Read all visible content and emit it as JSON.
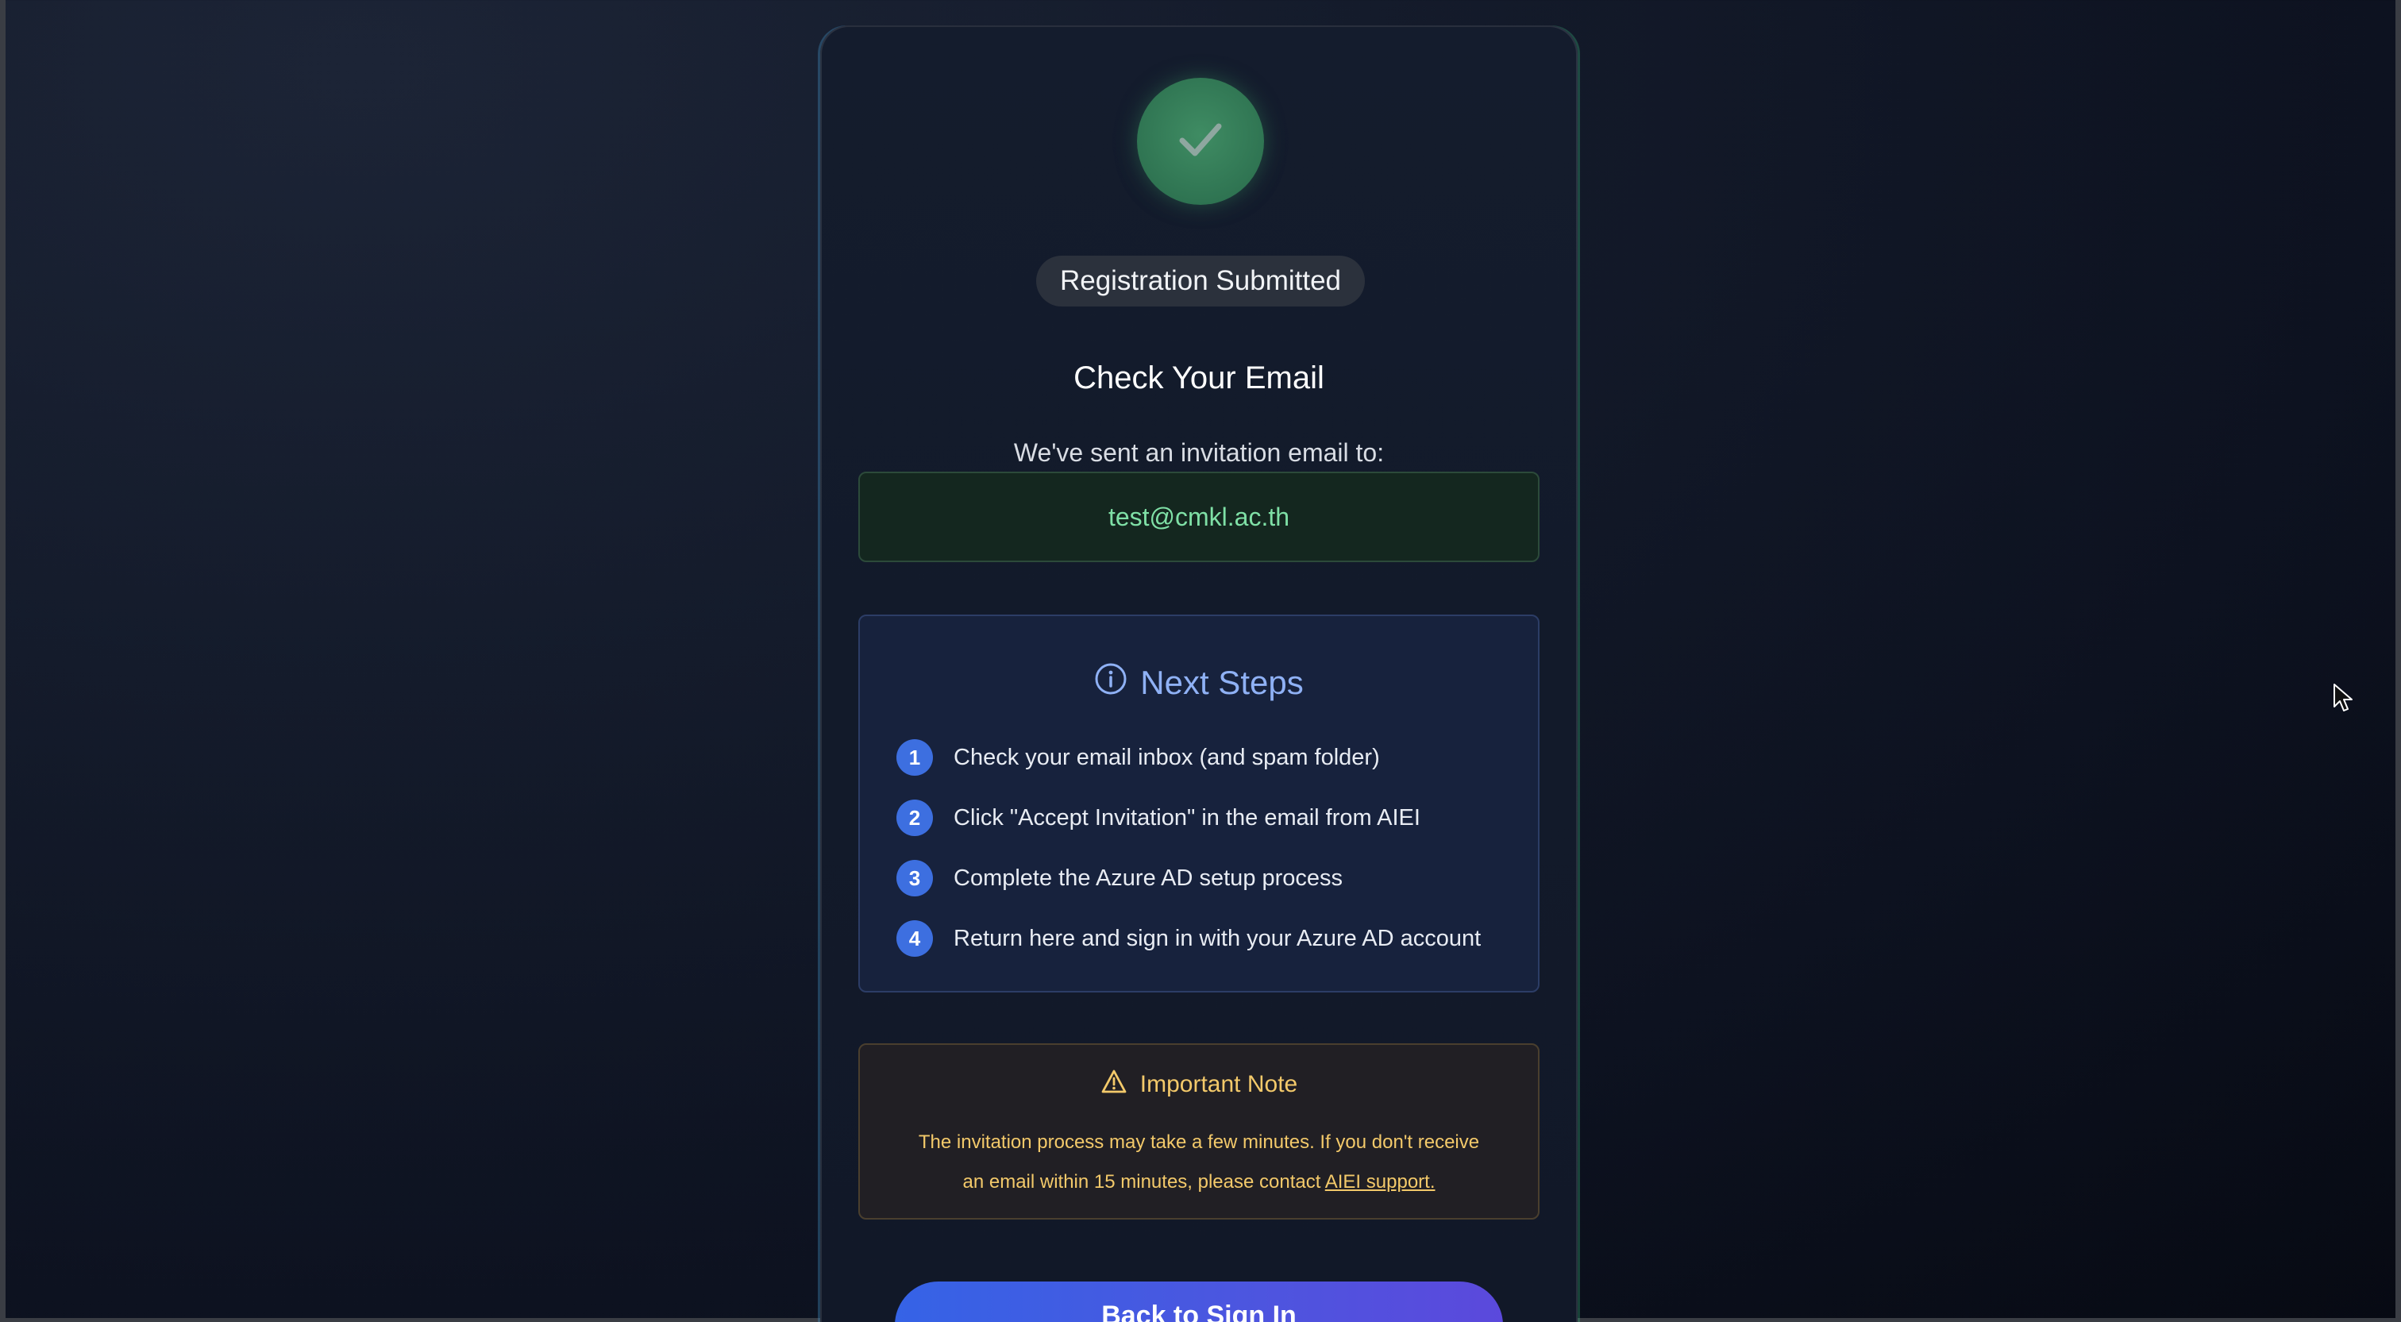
{
  "status_badge": "Registration Submitted",
  "title": "Check Your Email",
  "subtitle": "We've sent an invitation email to:",
  "email": "test@cmkl.ac.th",
  "next_steps": {
    "heading": "Next Steps",
    "icon": "info-circle-icon",
    "items": [
      {
        "number": "1",
        "text": "Check your email inbox (and spam folder)"
      },
      {
        "number": "2",
        "text": "Click \"Accept Invitation\" in the email from AIEI"
      },
      {
        "number": "3",
        "text": "Complete the Azure AD setup process"
      },
      {
        "number": "4",
        "text": "Return here and sign in with your Azure AD account"
      }
    ]
  },
  "important_note": {
    "heading": "Important Note",
    "icon": "warning-triangle-icon",
    "text_line1": "The invitation process may take a few minutes. If you don't receive",
    "text_line2": "an email within 15 minutes, please contact",
    "link_text": "AIEI support."
  },
  "back_button_label": "Back to Sign In",
  "colors": {
    "success_green": "#2f7452",
    "email_text": "#7fe0a6",
    "steps_accent": "#8fb1f5",
    "step_badge": "#3d6fe0",
    "warning": "#f3c96a",
    "button_start": "#3563e6",
    "button_end": "#5b49dc"
  }
}
